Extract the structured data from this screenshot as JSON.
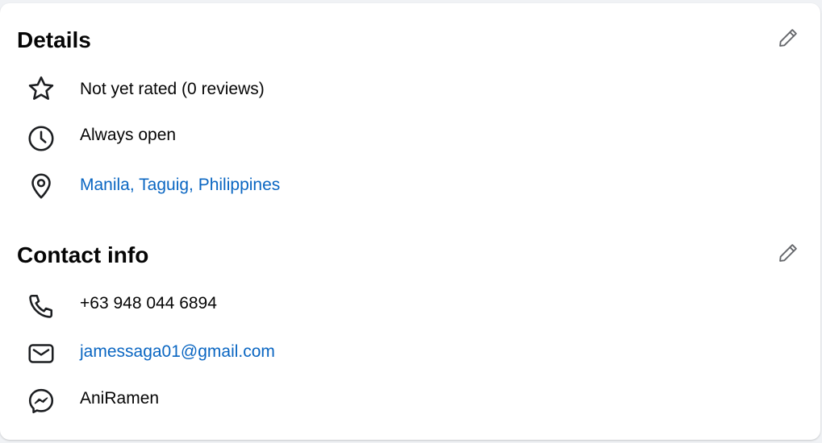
{
  "details": {
    "title": "Details",
    "edit_icon": "pencil-icon",
    "items": [
      {
        "icon": "star-icon",
        "text": "Not yet rated (0 reviews)",
        "is_link": false
      },
      {
        "icon": "clock-icon",
        "text": "Always open",
        "is_link": false
      },
      {
        "icon": "location-pin-icon",
        "text": "Manila, Taguig, Philippines",
        "is_link": true
      }
    ]
  },
  "contact": {
    "title": "Contact info",
    "edit_icon": "pencil-icon",
    "items": [
      {
        "icon": "phone-icon",
        "text": "+63 948 044 6894",
        "is_link": false
      },
      {
        "icon": "mail-icon",
        "text": "jamessaga01@gmail.com",
        "is_link": true
      },
      {
        "icon": "messenger-icon",
        "text": "AniRamen",
        "is_link": false
      }
    ]
  },
  "colors": {
    "link": "#0a66c2",
    "text": "#050505",
    "icon": "#1c1e21",
    "background": "#f0f2f5",
    "card": "#ffffff"
  }
}
